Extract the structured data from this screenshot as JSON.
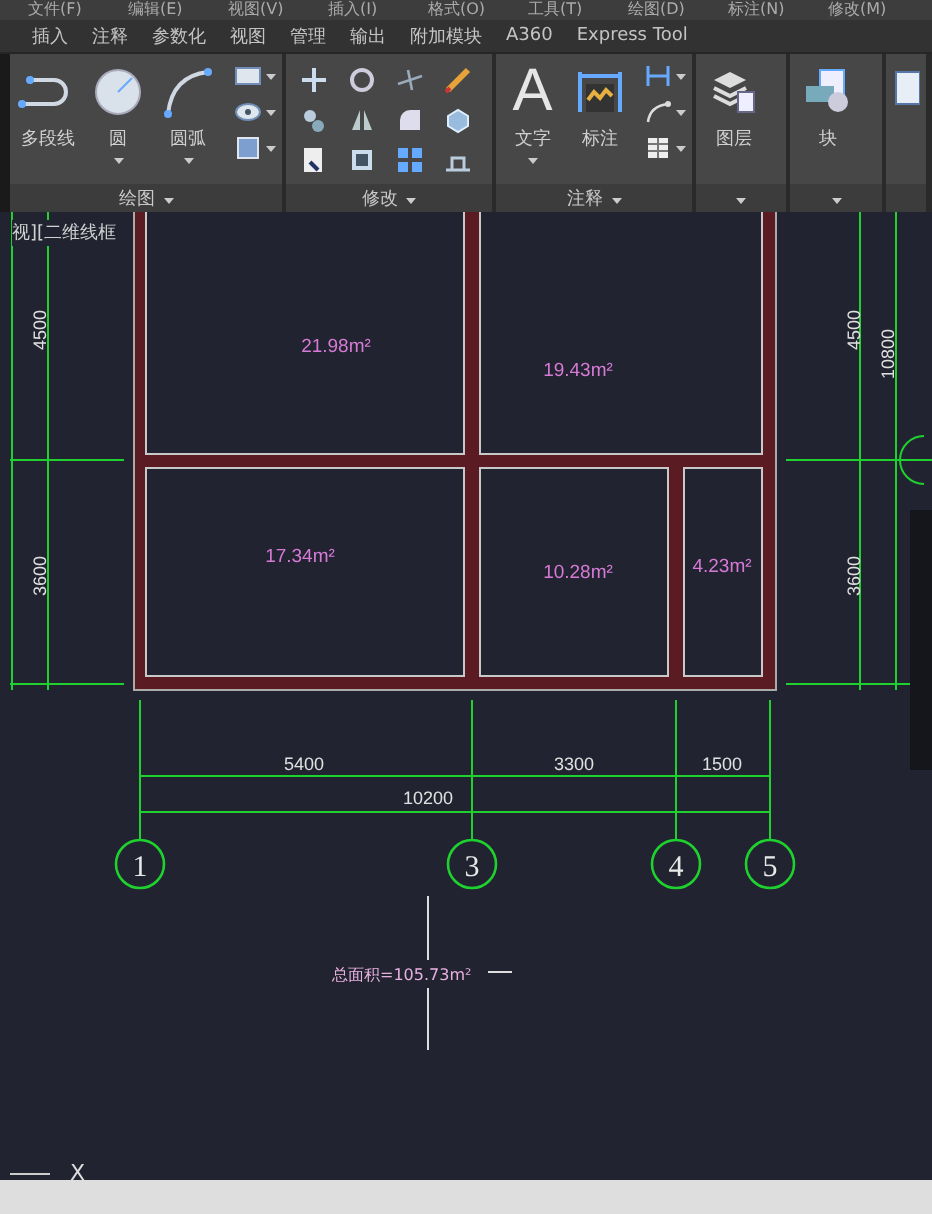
{
  "menu_bar": [
    {
      "label": "文件(F)"
    },
    {
      "label": "编辑(E)"
    },
    {
      "label": "视图(V)"
    },
    {
      "label": "插入(I)"
    },
    {
      "label": "格式(O)"
    },
    {
      "label": "工具(T)"
    },
    {
      "label": "绘图(D)"
    },
    {
      "label": "标注(N)"
    },
    {
      "label": "修改(M)"
    }
  ],
  "ribbon_tabs": [
    {
      "label": "插入",
      "selected": false
    },
    {
      "label": "注释",
      "selected": false
    },
    {
      "label": "参数化",
      "selected": false
    },
    {
      "label": "视图",
      "selected": false
    },
    {
      "label": "管理",
      "selected": false
    },
    {
      "label": "输出",
      "selected": false
    },
    {
      "label": "附加模块",
      "selected": false
    },
    {
      "label": "A360",
      "selected": false
    },
    {
      "label": "Express Tool",
      "selected": false
    }
  ],
  "ribbon_panels": [
    {
      "kind": "draw",
      "title": "绘图",
      "tools": [
        {
          "kind": "polyline",
          "label": "多段线"
        },
        {
          "kind": "circle",
          "label": "圆"
        },
        {
          "kind": "arc",
          "label": "圆弧"
        }
      ]
    },
    {
      "kind": "modify",
      "title": "修改"
    },
    {
      "kind": "annotate",
      "title": "注释",
      "tools": [
        {
          "kind": "text",
          "glyph": "A",
          "label": "文字"
        },
        {
          "kind": "dimension",
          "label": "标注"
        }
      ]
    },
    {
      "kind": "layers",
      "tools": [
        {
          "kind": "layers",
          "label": "图层"
        }
      ]
    },
    {
      "kind": "block",
      "tools": [
        {
          "kind": "block",
          "label": "块"
        }
      ]
    },
    {
      "kind": "partial"
    }
  ],
  "drawing": {
    "viewport_label": "视][二维线框",
    "rooms": [
      {
        "area": "21.98m²"
      },
      {
        "area": "19.43m²"
      },
      {
        "area": "17.34m²"
      },
      {
        "area": "10.28m²"
      },
      {
        "area": "4.23m²"
      }
    ],
    "left_dimensions": [
      "4500",
      "3600"
    ],
    "right_dimensions": [
      "4500",
      "3600"
    ],
    "right_total": "10800",
    "bottom_dimensions": [
      "5400",
      "3300",
      "1500"
    ],
    "bottom_total": "10200",
    "axes": [
      "1",
      "3",
      "4",
      "5"
    ],
    "cursor_text": "总面积=105.73m²",
    "ucs_label": "X"
  }
}
